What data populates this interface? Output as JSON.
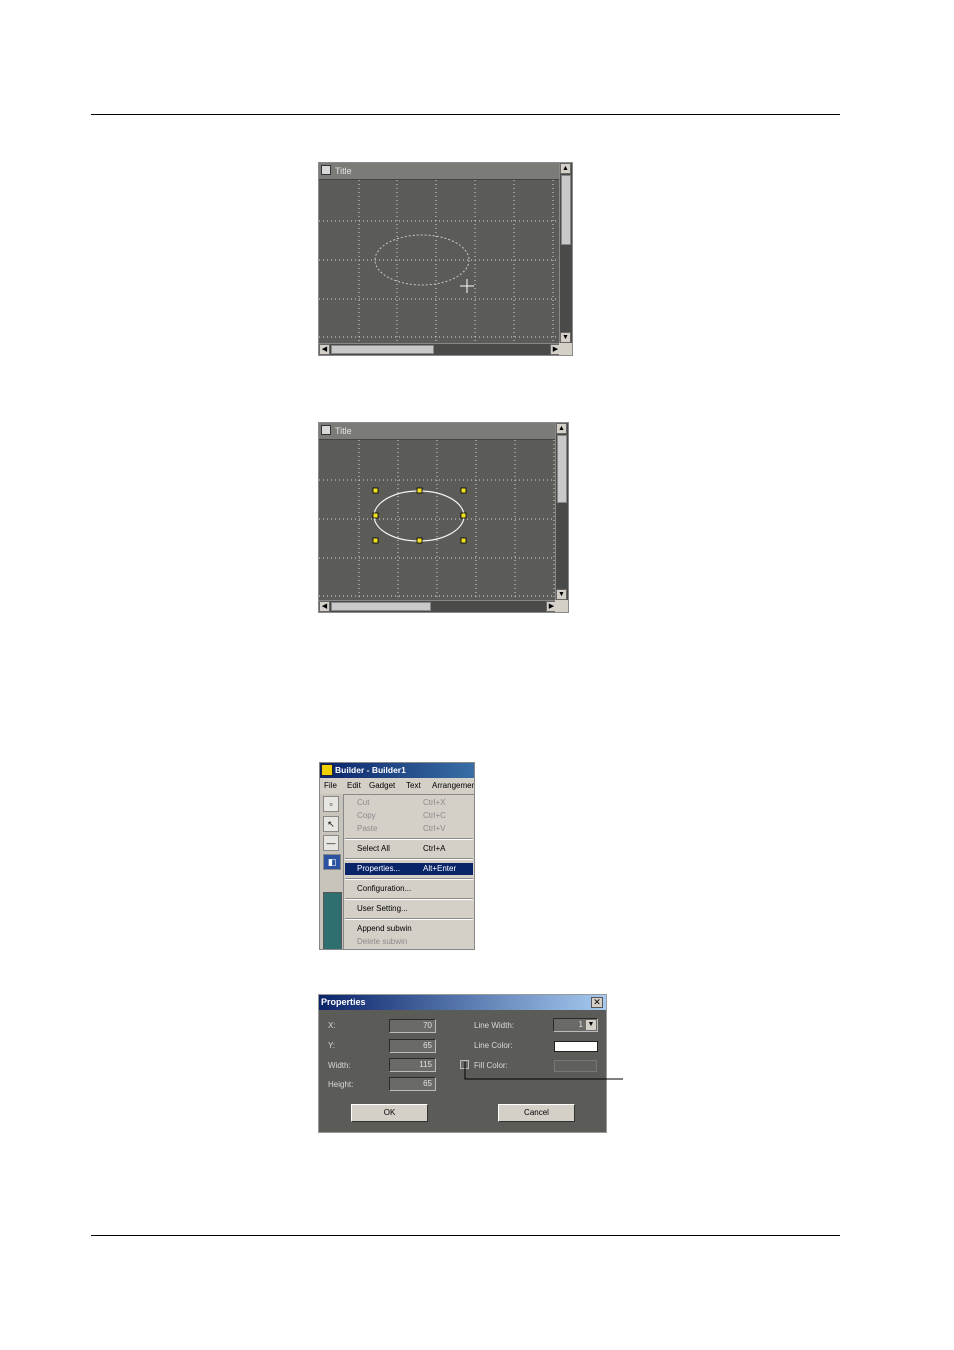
{
  "figure1": {
    "title": "Title"
  },
  "figure2": {
    "title": "Title"
  },
  "builder": {
    "title": "Builder - Builder1",
    "menubar": [
      "File",
      "Edit",
      "Gadget",
      "Text",
      "Arrangemen"
    ],
    "menu_items": [
      {
        "label": "Cut",
        "shortcut": "Ctrl+X",
        "disabled": true
      },
      {
        "label": "Copy",
        "shortcut": "Ctrl+C",
        "disabled": true
      },
      {
        "label": "Paste",
        "shortcut": "Ctrl+V",
        "disabled": true
      },
      {
        "label": "Select All",
        "shortcut": "Ctrl+A"
      },
      {
        "label": "Properties...",
        "shortcut": "Alt+Enter",
        "selected": true
      },
      {
        "label": "Configuration..."
      },
      {
        "label": "User Setting..."
      },
      {
        "label": "Append subwin"
      },
      {
        "label": "Delete subwin",
        "disabled": true
      }
    ]
  },
  "properties": {
    "title": "Properties",
    "x_label": "X:",
    "x_value": "70",
    "y_label": "Y:",
    "y_value": "65",
    "width_label": "Width:",
    "width_value": "115",
    "height_label": "Height:",
    "height_value": "65",
    "line_width_label": "Line Width:",
    "line_width_value": "1",
    "line_color_label": "Line Color:",
    "line_color": "#ffffff",
    "fill_color_label": "Fill Color:",
    "ok_label": "OK",
    "cancel_label": "Cancel"
  }
}
